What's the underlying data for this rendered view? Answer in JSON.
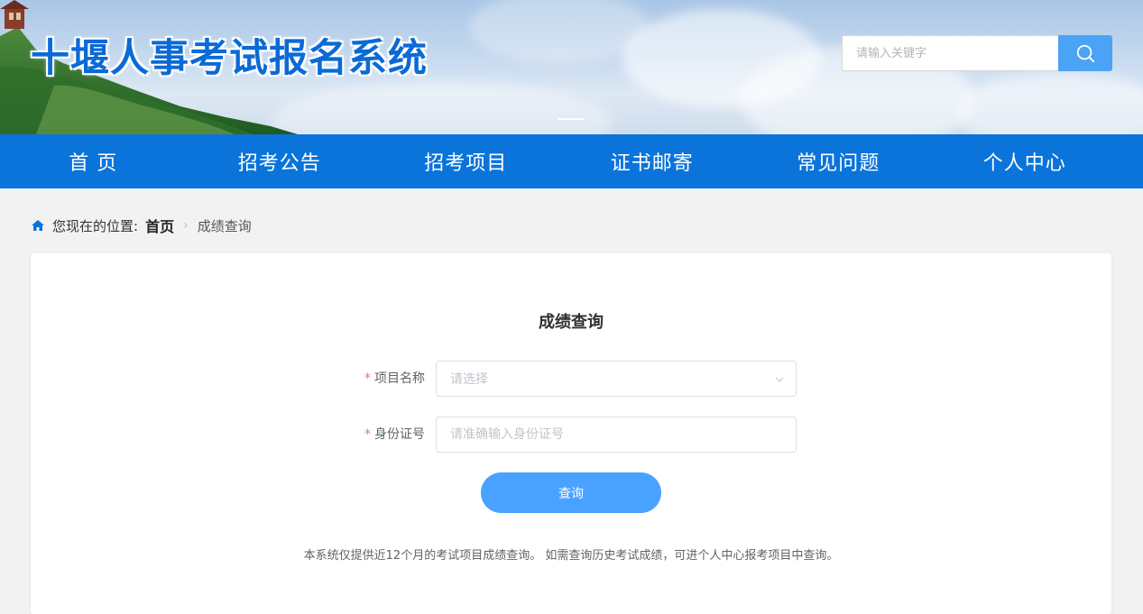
{
  "header": {
    "site_title": "十堰人事考试报名系统",
    "search_placeholder": "请输入关键字",
    "search_icon": "search-icon"
  },
  "nav": {
    "items": [
      {
        "label": "首 页"
      },
      {
        "label": "招考公告"
      },
      {
        "label": "招考项目"
      },
      {
        "label": "证书邮寄"
      },
      {
        "label": "常见问题"
      },
      {
        "label": "个人中心"
      }
    ]
  },
  "breadcrumb": {
    "home_icon": "home-icon",
    "prefix": "您现在的位置:",
    "home_link": "首页",
    "separator": "›",
    "current": "成绩查询"
  },
  "form": {
    "title": "成绩查询",
    "required_mark": "*",
    "project_label": "项目名称",
    "project_placeholder": "请选择",
    "id_label": "身份证号",
    "id_placeholder": "请准确输入身份证号",
    "submit_label": "查询",
    "note": "本系统仅提供近12个月的考试项目成绩查询。 如需查询历史考试成绩，可进个人中心报考项目中查询。"
  },
  "colors": {
    "nav_bg": "#0a74db",
    "title_blue": "#0a6ad7",
    "button_blue": "#409eff",
    "search_button": "#4aa3f5",
    "required_red": "#f56c6c"
  }
}
